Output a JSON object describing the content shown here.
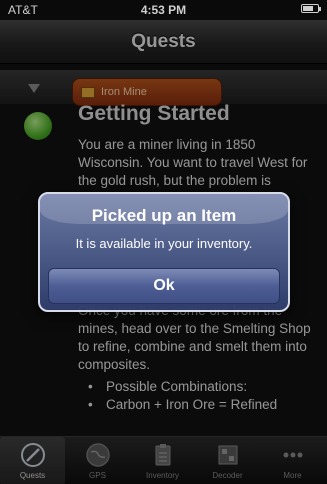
{
  "status_bar": {
    "carrier": "AT&T",
    "time": "4:53 PM"
  },
  "nav": {
    "title": "Quests"
  },
  "quest": {
    "tag_label": "Iron Mine",
    "title": "Getting Started",
    "intro": "You are a miner living in 1850 Wisconsin. You want to travel West for the gold rush, but the problem is",
    "body": "Once you have some ore from the mines, head over to the Smelting Shop to refine, combine and smelt them into composites.",
    "bullets": [
      "Possible Combinations:",
      "Carbon + Iron Ore = Refined"
    ]
  },
  "alert": {
    "title": "Picked up an Item",
    "message": "It is available in your inventory.",
    "ok_label": "Ok"
  },
  "tabs": [
    {
      "label": "Quests",
      "icon": "compass-icon",
      "active": true
    },
    {
      "label": "GPS",
      "icon": "globe-icon",
      "active": false
    },
    {
      "label": "Inventory",
      "icon": "clipboard-icon",
      "active": false
    },
    {
      "label": "Decoder",
      "icon": "grid-icon",
      "active": false
    },
    {
      "label": "More",
      "icon": "more-icon",
      "active": false
    }
  ],
  "colors": {
    "quest_tag": "#a8461a",
    "alert_bg": "#4e5e95",
    "quest_dot": "#4caf28"
  }
}
